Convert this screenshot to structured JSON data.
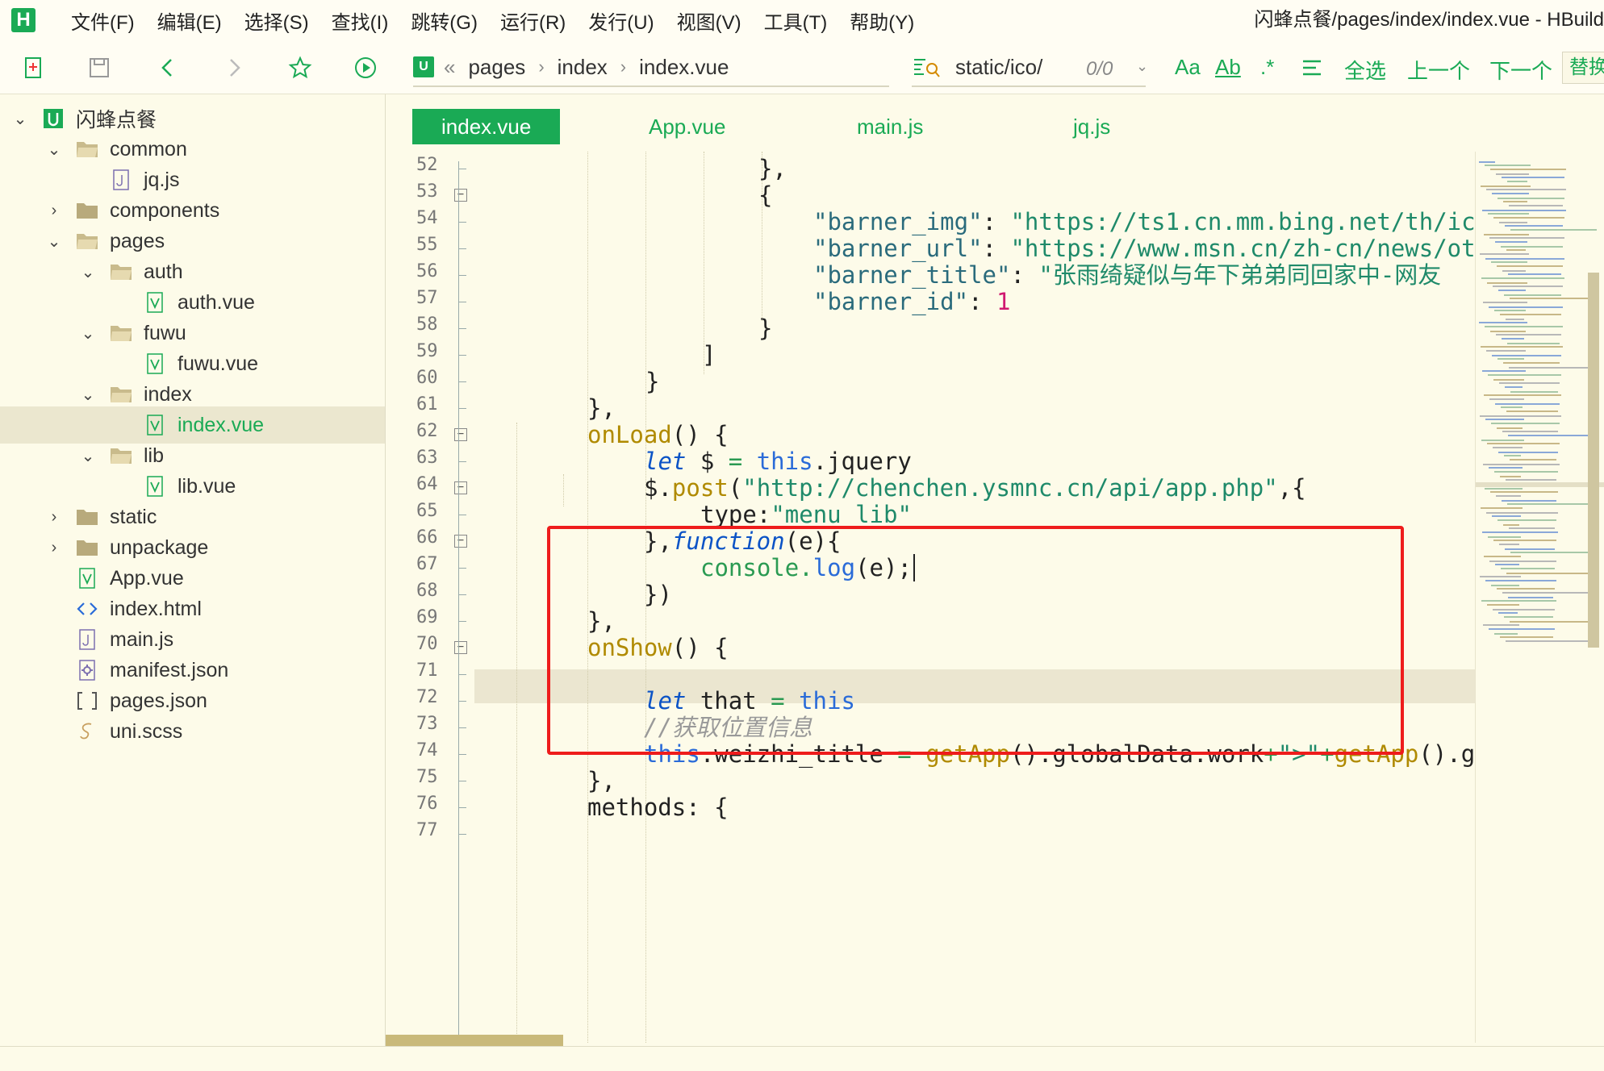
{
  "app": {
    "logo_letter": "H",
    "window_title": "闪蜂点餐/pages/index/index.vue - HBuild",
    "accent": "#1aaa55"
  },
  "menu": [
    "文件(F)",
    "编辑(E)",
    "选择(S)",
    "查找(I)",
    "跳转(G)",
    "运行(R)",
    "发行(U)",
    "视图(V)",
    "工具(T)",
    "帮助(Y)"
  ],
  "toolbar": {
    "breadcrumb_mark": "U",
    "breadcrumb_chevrons": "«",
    "breadcrumb": [
      "pages",
      "index",
      "index.vue"
    ],
    "breadcrumb_sep": "›",
    "search_value": "static/ico/",
    "find_count": "0/0",
    "find_dropdown": "⌄",
    "case_label": "Aa",
    "word_label": "Ab",
    "regex_label": ".*",
    "select_all": "全选",
    "prev": "上一个",
    "next": "下一个",
    "replace": "替换"
  },
  "tree": [
    {
      "label": "闪蜂点餐",
      "chev": "⌄",
      "type": "project"
    },
    {
      "label": "common",
      "chev": "⌄",
      "type": "folder-open"
    },
    {
      "label": "jq.js",
      "chev": "",
      "type": "js"
    },
    {
      "label": "components",
      "chev": "›",
      "type": "folder"
    },
    {
      "label": "pages",
      "chev": "⌄",
      "type": "folder-open"
    },
    {
      "label": "auth",
      "chev": "⌄",
      "type": "folder-open"
    },
    {
      "label": "auth.vue",
      "chev": "",
      "type": "vue"
    },
    {
      "label": "fuwu",
      "chev": "⌄",
      "type": "folder-open"
    },
    {
      "label": "fuwu.vue",
      "chev": "",
      "type": "vue"
    },
    {
      "label": "index",
      "chev": "⌄",
      "type": "folder-open"
    },
    {
      "label": "index.vue",
      "chev": "",
      "type": "vue"
    },
    {
      "label": "lib",
      "chev": "⌄",
      "type": "folder-open"
    },
    {
      "label": "lib.vue",
      "chev": "",
      "type": "vue"
    },
    {
      "label": "static",
      "chev": "›",
      "type": "folder"
    },
    {
      "label": "unpackage",
      "chev": "›",
      "type": "folder"
    },
    {
      "label": "App.vue",
      "chev": "",
      "type": "vue"
    },
    {
      "label": "index.html",
      "chev": "",
      "type": "html"
    },
    {
      "label": "main.js",
      "chev": "",
      "type": "js"
    },
    {
      "label": "manifest.json",
      "chev": "",
      "type": "manifest"
    },
    {
      "label": "pages.json",
      "chev": "",
      "type": "json"
    },
    {
      "label": "uni.scss",
      "chev": "",
      "type": "scss"
    }
  ],
  "tabs": [
    "index.vue",
    "App.vue",
    "main.js",
    "jq.js"
  ],
  "line_numbers": [
    "52",
    "53",
    "54",
    "55",
    "56",
    "57",
    "58",
    "59",
    "60",
    "61",
    "62",
    "63",
    "64",
    "65",
    "66",
    "67",
    "68",
    "69",
    "70",
    "71",
    "72",
    "73",
    "74",
    "75",
    "76",
    "77"
  ],
  "code": {
    "l52": "},",
    "l53": "{",
    "l54_key": "\"barner_img\"",
    "l54_val": "\"https://ts1.cn.mm.bing.net/th/ic",
    "l55_key": "\"barner_url\"",
    "l55_val": "\"https://www.msn.cn/zh-cn/news/ot",
    "l56_key": "\"barner_title\"",
    "l56_val": "\"张雨绮疑似与年下弟弟同回家中-网友",
    "l57_key": "\"barner_id\"",
    "l57_val": "1",
    "l58": "}",
    "l59": "]",
    "l60": "}",
    "l61": "},",
    "l62_fn": "onLoad",
    "l62_rest": "() {",
    "l63_kw": "let",
    "l63_var": " $ ",
    "l63_op": "=",
    "l63_this": " this",
    "l63_rest": ".jquery",
    "l64_a": "$.",
    "l64_fn": "post",
    "l64_b": "(",
    "l64_str": "\"http://chenchen.ysmnc.cn/api/app.php\"",
    "l64_c": ",{",
    "l65_key": "type:",
    "l65_val": "\"menu_lib\"",
    "l66_a": "},",
    "l66_kw": "function",
    "l66_b": "(e){",
    "l67_obj": "console.",
    "l67_fn": "log",
    "l67_rest": "(e);",
    "l68": "})",
    "l69": "},",
    "l70_fn": "onShow",
    "l70_rest": "() {",
    "l72_kw": "let",
    "l72_var": " that ",
    "l72_op": "=",
    "l72_this": " this",
    "l73_cm": "//获取位置信息",
    "l74_this": "this",
    "l74_a": ".weizhi_title ",
    "l74_op": "=",
    "l74_fn1": " getApp",
    "l74_b": "().globalData.work",
    "l74_plus": "+",
    "l74_str": "\">\"",
    "l74_plus2": "+",
    "l74_fn2": "getApp",
    "l74_c": "().g",
    "l75": "},",
    "l76": "methods: {"
  }
}
